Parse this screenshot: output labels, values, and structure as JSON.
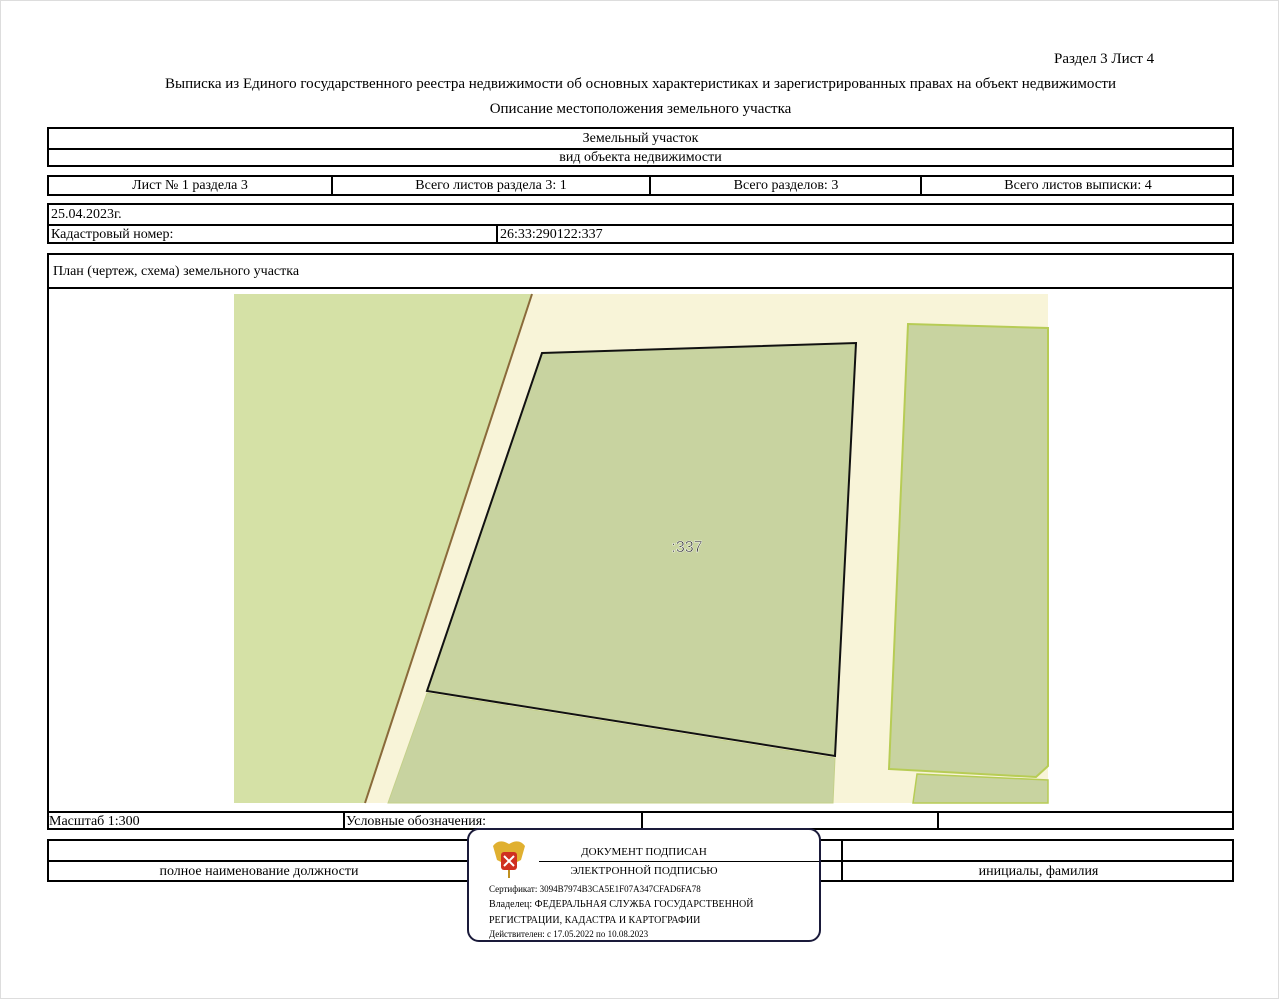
{
  "header": {
    "section_sheet": "Раздел 3    Лист 4",
    "title": "Выписка из Единого государственного реестра недвижимости об основных характеристиках и зарегистрированных правах на объект недвижимости",
    "subtitle": "Описание местоположения земельного участка"
  },
  "object": {
    "type": "Земельный участок",
    "type_caption": "вид объекта недвижимости"
  },
  "sheets": [
    "Лист № 1 раздела 3",
    "Всего листов раздела 3: 1",
    "Всего разделов: 3",
    "Всего листов выписки: 4"
  ],
  "date": "25.04.2023г.",
  "cadastral": {
    "label": "Кадастровый номер:",
    "value": "26:33:290122:337"
  },
  "plan": {
    "title": "План (чертеж, схема) земельного участка",
    "parcel_label": ":337"
  },
  "footer": {
    "scale": "Масштаб 1:300",
    "legend": "Условные обозначения:",
    "position_caption": "полное наименование должности",
    "name_caption": "инициалы, фамилия"
  },
  "stamp": {
    "line1": "ДОКУМЕНТ ПОДПИСАН",
    "line2": "ЭЛЕКТРОННОЙ ПОДПИСЬЮ",
    "certificate": "Сертификат: 3094B7974B3CA5E1F07A347CFAD6FA78",
    "owner1": "Владелец: ФЕДЕРАЛЬНАЯ СЛУЖБА ГОСУДАРСТВЕННОЙ",
    "owner2": "РЕГИСТРАЦИИ, КАДАСТРА И КАРТОГРАФИИ",
    "valid": "Действителен: с 17.05.2022 по 10.08.2023"
  },
  "colors": {
    "parcel": "#c8d3a0",
    "land": "#d5e1a6",
    "road": "#f8f4d8",
    "stamp_border": "#1a1a3a"
  }
}
